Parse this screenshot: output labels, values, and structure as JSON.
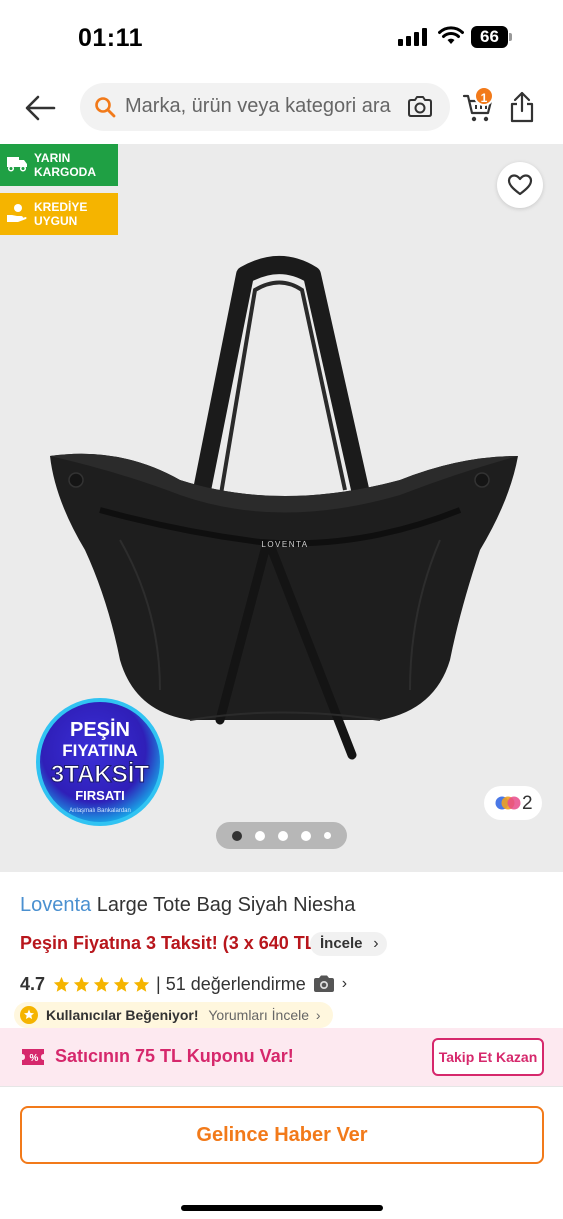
{
  "status_bar": {
    "time": "01:11",
    "battery": "66"
  },
  "header": {
    "search_placeholder": "Marka, ürün veya kategori ara",
    "cart_badge": "1",
    "icons": [
      "back-arrow-icon",
      "search-icon",
      "camera-icon",
      "cart-icon",
      "share-icon"
    ]
  },
  "gallery": {
    "tags": [
      {
        "line1": "YARIN",
        "line2": "KARGODA",
        "color": "#1fa044",
        "icon": "truck-icon"
      },
      {
        "line1": "KREDİYE",
        "line2": "UYGUN",
        "color": "#f5b400",
        "icon": "credit-hand-icon"
      }
    ],
    "bag_logo": "LOVENTA",
    "promo_seal": {
      "line1": "PEŞİN",
      "line2": "FIYATINA",
      "line3": "3TAKSİT",
      "line4": "FIRSATI",
      "line5": "Anlaşmalı Bankalardan"
    },
    "variant_count": "2",
    "pager": {
      "total": 5,
      "active": 0
    }
  },
  "product": {
    "brand": "Loventa",
    "name": "Large Tote Bag Siyah Niesha",
    "installment_text": "Peşin Fiyatına 3 Taksit! (3 x 640 TL)",
    "review_button": "İncele",
    "rating": "4.7",
    "stars": 5,
    "rating_count": "| 51 değerlendirme",
    "liked_label": "Kullanıcılar Beğeniyor!",
    "liked_link": "Yorumları İncele"
  },
  "coupon": {
    "text": "Satıcının 75 TL Kuponu Var!",
    "button": "Takip Et Kazan"
  },
  "bottom": {
    "notify_button": "Gelince Haber Ver"
  },
  "colors": {
    "brand_orange": "#f27a1a",
    "brand_link": "#4a90d0",
    "installment_red": "#b8161c",
    "coupon_pink": "#d6286c",
    "star_yellow": "#f5b400"
  }
}
